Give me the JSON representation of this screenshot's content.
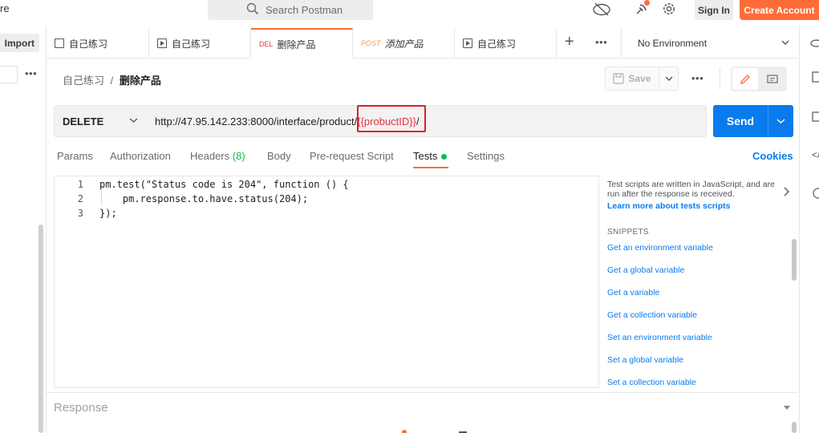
{
  "topbar": {
    "app_cut_text": "re",
    "search_placeholder": "Search Postman",
    "sign_in": "Sign In",
    "create_account": "Create Account"
  },
  "sidebar": {
    "import": "Import"
  },
  "tabs": [
    {
      "label": "自己练习",
      "icon": "file-icon"
    },
    {
      "label": "自己练习",
      "icon": "runner-icon"
    },
    {
      "method": "DEL",
      "label": "删除产品",
      "active": true
    },
    {
      "method": "POST",
      "label": "添加产品"
    },
    {
      "label": "自己练习",
      "icon": "runner-icon"
    }
  ],
  "environment": "No Environment",
  "breadcrumb": {
    "parent": "自己练习",
    "separator": "/",
    "current": "删除产品"
  },
  "toolbar": {
    "save": "Save"
  },
  "request": {
    "method": "DELETE",
    "url_prefix": "http://47.95.142.233:8000/interface/product/",
    "url_variable": "{{probuctID}}",
    "url_suffix": "/",
    "send": "Send"
  },
  "request_tabs": {
    "params": "Params",
    "authorization": "Authorization",
    "headers": "Headers",
    "headers_count": "(8)",
    "body": "Body",
    "prerequest": "Pre-request Script",
    "tests": "Tests",
    "settings": "Settings",
    "cookies": "Cookies"
  },
  "editor": {
    "line_numbers": [
      "1",
      "2",
      "3"
    ],
    "lines": [
      "pm.test(\"Status code is 204\", function () {",
      "    pm.response.to.have.status(204);",
      "});"
    ]
  },
  "snippets": {
    "description": "Test scripts are written in JavaScript, and are run after the response is received.",
    "learn_more": "Learn more about tests scripts",
    "title": "SNIPPETS",
    "items": [
      "Get an environment variable",
      "Get a global variable",
      "Get a variable",
      "Get a collection variable",
      "Set an environment variable",
      "Set a global variable",
      "Set a collection variable"
    ]
  },
  "response": {
    "label": "Response"
  },
  "colors": {
    "accent": "#ff6c37",
    "primary_blue": "#097bed",
    "delete_red": "#e5323d",
    "post_orange": "#f5a04a",
    "success_green": "#0cbb52"
  }
}
